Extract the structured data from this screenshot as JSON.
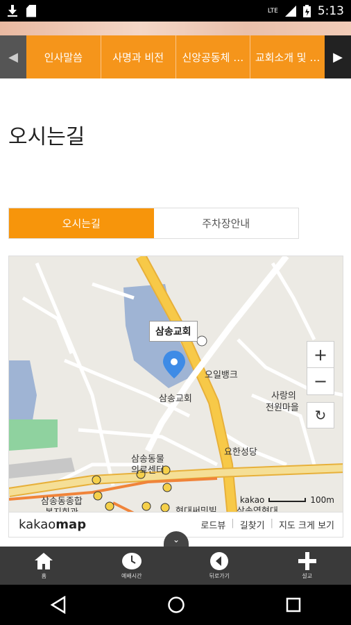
{
  "status_bar": {
    "time": "5:13",
    "network": "LTE"
  },
  "nav": {
    "tabs": [
      "인사말씀",
      "사명과 비전",
      "신앙공동체 …",
      "교회소개 및 …"
    ]
  },
  "page_title": "오시는길",
  "subtabs": [
    "오시는길",
    "주차장안내"
  ],
  "map": {
    "popup": "삼송교회",
    "labels": {
      "church": "삼송교회",
      "oil_bank": "오일뱅크",
      "village_1": "사랑의",
      "village_2": "전원마을",
      "cathedral": "요한성당",
      "animal_1": "삼송동물",
      "animal_2": "의료센터",
      "complex_1": "삼송동종합",
      "complex_2": "복지회관",
      "hyundai": "현대써밋빌",
      "station": "삼송역현대"
    },
    "zoom_in": "+",
    "zoom_out": "−",
    "scale_brand": "kakao",
    "scale_value": "100m",
    "footer": {
      "logo_light": "kakao",
      "logo_bold": "map",
      "links": [
        "로드뷰",
        "길찾기",
        "지도 크게 보기"
      ]
    }
  },
  "appbar": [
    {
      "label": "홈",
      "icon": "home-icon"
    },
    {
      "label": "예배시간",
      "icon": "clock-icon"
    },
    {
      "label": "뒤로가기",
      "icon": "back-icon"
    },
    {
      "label": "설교",
      "icon": "plus-icon"
    }
  ]
}
